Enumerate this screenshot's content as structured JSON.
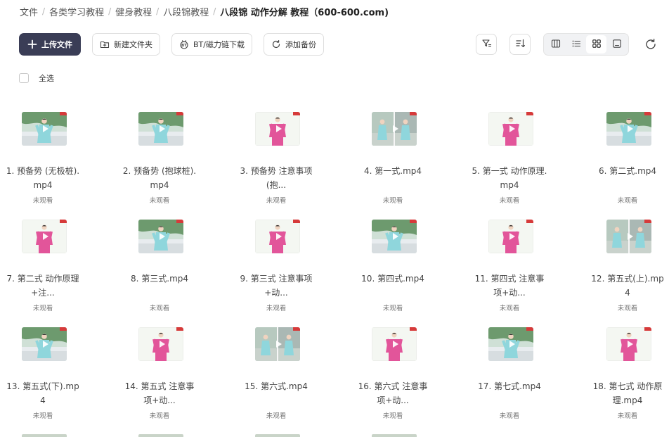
{
  "breadcrumb": {
    "items": [
      "文件",
      "各类学习教程",
      "健身教程",
      "八段锦教程"
    ],
    "current": "八段锦 动作分解 教程（600-600.com)"
  },
  "toolbar": {
    "upload_label": "上传文件",
    "new_folder_label": "新建文件夹",
    "bt_label": "BT/磁力链下载",
    "backup_label": "添加备份"
  },
  "select_all_label": "全选",
  "files": [
    {
      "name": "1. 预备势 (无极桩).mp4",
      "status": "未观看",
      "scene": "outdoor"
    },
    {
      "name": "2. 预备势 (抱球桩).mp4",
      "status": "未观看",
      "scene": "outdoor"
    },
    {
      "name": "3. 预备势 注意事项 (抱...",
      "status": "未观看",
      "scene": "studio"
    },
    {
      "name": "4. 第一式.mp4",
      "status": "未观看",
      "scene": "split"
    },
    {
      "name": "5. 第一式 动作原理.mp4",
      "status": "未观看",
      "scene": "studio"
    },
    {
      "name": "6. 第二式.mp4",
      "status": "未观看",
      "scene": "outdoor"
    },
    {
      "name": "7. 第二式 动作原理+注...",
      "status": "未观看",
      "scene": "studio"
    },
    {
      "name": "8. 第三式.mp4",
      "status": "未观看",
      "scene": "outdoor"
    },
    {
      "name": "9. 第三式 注意事项+动...",
      "status": "未观看",
      "scene": "studio"
    },
    {
      "name": "10. 第四式.mp4",
      "status": "未观看",
      "scene": "outdoor"
    },
    {
      "name": "11. 第四式 注意事项+动...",
      "status": "未观看",
      "scene": "studio"
    },
    {
      "name": "12. 第五式(上).mp4",
      "status": "未观看",
      "scene": "split"
    },
    {
      "name": "13. 第五式(下).mp4",
      "status": "未观看",
      "scene": "outdoor"
    },
    {
      "name": "14. 第五式 注意事项+动...",
      "status": "未观看",
      "scene": "studio"
    },
    {
      "name": "15. 第六式.mp4",
      "status": "未观看",
      "scene": "split"
    },
    {
      "name": "16. 第六式 注意事项+动...",
      "status": "未观看",
      "scene": "studio"
    },
    {
      "name": "17. 第七式.mp4",
      "status": "未观看",
      "scene": "outdoor"
    },
    {
      "name": "18. 第七式 动作原理.mp4",
      "status": "未观看",
      "scene": "studio"
    }
  ],
  "colors": {
    "primary_button": "#3a3d56",
    "studio_bg": "#f4f7f2",
    "outfit_pink": "#e2559a",
    "outfit_cyan": "#8fd6dc",
    "corner_badge": "#d63a3a"
  }
}
